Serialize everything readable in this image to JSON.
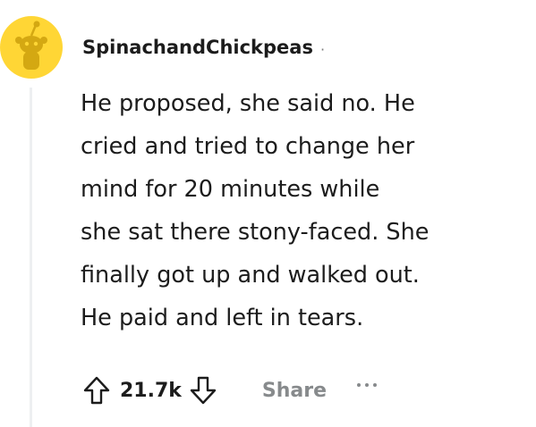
{
  "comment": {
    "author": "SpinachandChickpeas",
    "separator": "·",
    "body_lines": [
      "He proposed, she said no. He",
      "cried and tried to change her",
      "mind for 20 minutes while",
      "she sat there stony-faced. She",
      "finally got up and walked out.",
      "He paid and left in tears."
    ]
  },
  "actions": {
    "score": "21.7k",
    "share_label": "Share",
    "upvote_icon": "arrow-up-outline-icon",
    "downvote_icon": "arrow-down-outline-icon",
    "more_icon": "ellipsis-icon"
  },
  "colors": {
    "avatar_bg": "#FFD635",
    "avatar_figure": "#D4A812",
    "text": "#1C1C1C",
    "muted": "#878A8C",
    "thread_line": "#EDEFF1"
  }
}
